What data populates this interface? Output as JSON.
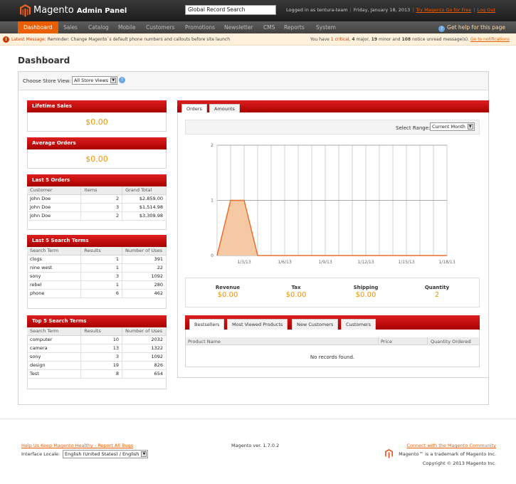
{
  "colors": {
    "accent": "#eb5e00",
    "header_red": "#c40000",
    "value_orange": "#eb9500",
    "chart_fill": "#f5c9a4",
    "chart_line": "#e8702a"
  },
  "header": {
    "logo_name": "Magento",
    "logo_suffix": "Admin Panel",
    "search_placeholder": "Global Record Search",
    "logged_in": "Logged in as tentura-team",
    "date": "Friday, January 18, 2013",
    "try_link": "Try Magento Go for Free",
    "logout": "Log Out"
  },
  "nav": {
    "items": [
      "Dashboard",
      "Sales",
      "Catalog",
      "Mobile",
      "Customers",
      "Promotions",
      "Newsletter",
      "CMS",
      "Reports",
      "System"
    ],
    "help": "Get help for this page"
  },
  "message": {
    "label": "Latest Message:",
    "text": "Reminder: Change Magento`s default phone numbers and callouts before site launch",
    "r_pre": "You have ",
    "r_crit": "1 critical",
    "r_major": "4",
    "r_major_lbl": " major, ",
    "r_minor": "19",
    "r_minor_lbl": " minor and ",
    "r_notice": "108",
    "r_notice_lbl": " notice unread message(s).",
    "r_link": "Go to notifications"
  },
  "page_title": "Dashboard",
  "store": {
    "label": "Choose Store View:",
    "value": "All Store Views"
  },
  "lifetime_sales": {
    "title": "Lifetime Sales",
    "value": "$0.00"
  },
  "average_orders": {
    "title": "Average Orders",
    "value": "$0.00"
  },
  "last_orders": {
    "title": "Last 5 Orders",
    "columns": [
      "Customer",
      "Items",
      "Grand Total"
    ],
    "rows": [
      [
        "John Doe",
        "2",
        "$2,859.00"
      ],
      [
        "John Doe",
        "3",
        "$1,514.98"
      ],
      [
        "John Doe",
        "2",
        "$3,309.98"
      ]
    ]
  },
  "last_search": {
    "title": "Last 5 Search Terms",
    "columns": [
      "Search Term",
      "Results",
      "Number of Uses"
    ],
    "rows": [
      [
        "clogs",
        "1",
        "391"
      ],
      [
        "nine west",
        "1",
        "22"
      ],
      [
        "sony",
        "3",
        "1092"
      ],
      [
        "rebel",
        "1",
        "280"
      ],
      [
        "phone",
        "6",
        "462"
      ]
    ]
  },
  "top_search": {
    "title": "Top 5 Search Terms",
    "columns": [
      "Search Term",
      "Results",
      "Number of Uses"
    ],
    "rows": [
      [
        "computer",
        "10",
        "2032"
      ],
      [
        "camera",
        "13",
        "1322"
      ],
      [
        "sony",
        "3",
        "1092"
      ],
      [
        "design",
        "19",
        "826"
      ],
      [
        "Test",
        "8",
        "654"
      ]
    ]
  },
  "diagram": {
    "tabs": [
      "Orders",
      "Amounts"
    ],
    "range_label": "Select Range:",
    "range_value": "Current Month"
  },
  "chart_data": {
    "type": "area",
    "x": [
      "1/1/13",
      "1/2/13",
      "1/3/13",
      "1/4/13",
      "1/5/13",
      "1/6/13",
      "1/7/13",
      "1/8/13",
      "1/9/13",
      "1/10/13",
      "1/11/13",
      "1/12/13",
      "1/13/13",
      "1/14/13",
      "1/15/13",
      "1/16/13",
      "1/17/13",
      "1/18/13"
    ],
    "tick_labels": [
      "1/3/13",
      "1/6/13",
      "1/9/13",
      "1/12/13",
      "1/15/13",
      "1/18/13"
    ],
    "values": [
      0,
      1,
      1,
      0,
      0,
      0,
      0,
      0,
      0,
      0,
      0,
      0,
      0,
      0,
      0,
      0,
      0,
      0
    ],
    "y_ticks": [
      "0",
      "1",
      "2"
    ],
    "ylim": [
      0,
      2
    ],
    "grid": true
  },
  "totals": [
    {
      "label": "Revenue",
      "value": "$0.00"
    },
    {
      "label": "Tax",
      "value": "$0.00"
    },
    {
      "label": "Shipping",
      "value": "$0.00"
    },
    {
      "label": "Quantity",
      "value": "2"
    }
  ],
  "grid_tabs": [
    "Bestsellers",
    "Most Viewed Products",
    "New Customers",
    "Customers"
  ],
  "products_grid": {
    "columns": [
      "Product Name",
      "Price",
      "Quantity Ordered"
    ],
    "empty": "No records found."
  },
  "footer": {
    "help_link": "Help Us Keep Magento Healthy - Report All Bugs",
    "locale_label": "Interface Locale:",
    "locale_value": "English (United States) / English",
    "version": "Magento ver. 1.7.0.2",
    "community": "Connect with the Magento Community",
    "trademark": "Magento™ is a trademark of Magento Inc.",
    "copyright": "Copyright © 2013 Magento Inc."
  }
}
